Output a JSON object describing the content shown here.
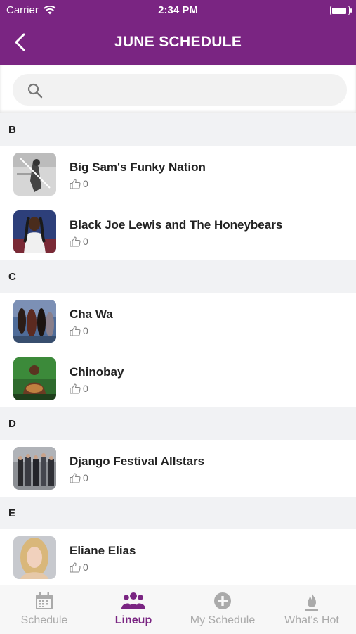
{
  "status_bar": {
    "carrier": "Carrier",
    "time": "2:34 PM",
    "battery_level": 1.0
  },
  "header": {
    "title": "JUNE SCHEDULE"
  },
  "search": {
    "placeholder": ""
  },
  "sections": [
    {
      "letter": "B",
      "artists": [
        {
          "name": "Big Sam's Funky Nation",
          "likes": "0"
        },
        {
          "name": "Black Joe Lewis and The Honeybears",
          "likes": "0"
        }
      ]
    },
    {
      "letter": "C",
      "artists": [
        {
          "name": "Cha Wa",
          "likes": "0"
        },
        {
          "name": "Chinobay",
          "likes": "0"
        }
      ]
    },
    {
      "letter": "D",
      "artists": [
        {
          "name": "Django Festival Allstars",
          "likes": "0"
        }
      ]
    },
    {
      "letter": "E",
      "artists": [
        {
          "name": "Eliane Elias",
          "likes": "0"
        }
      ]
    }
  ],
  "tabs": [
    {
      "label": "Schedule",
      "icon": "calendar-icon"
    },
    {
      "label": "Lineup",
      "icon": "group-icon"
    },
    {
      "label": "My Schedule",
      "icon": "plus-circle-icon"
    },
    {
      "label": "What's Hot",
      "icon": "flame-icon"
    }
  ],
  "active_tab": "Lineup",
  "colors": {
    "brand": "#7a2582",
    "inactive": "#aaaaaa"
  }
}
